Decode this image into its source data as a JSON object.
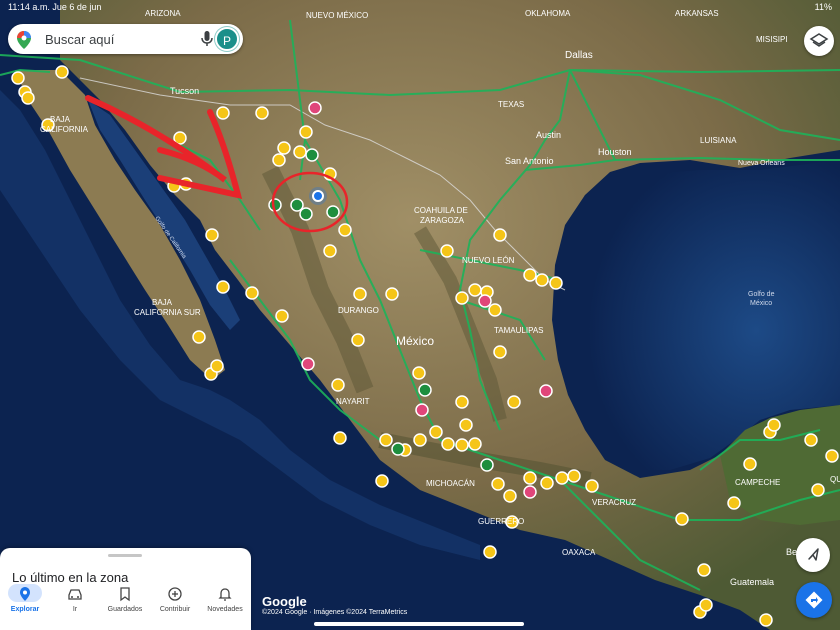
{
  "status_bar": {
    "time": "11:14 a.m.  Jue 6 de jun",
    "battery": "11%"
  },
  "search": {
    "placeholder": "Buscar aquí",
    "avatar_letter": "P"
  },
  "map": {
    "labels": {
      "arizona": "ARIZONA",
      "nuevo_mexico": "NUEVO\nMÉXICO",
      "oklahoma": "OKLAHOMA",
      "arkansas": "ARKANSAS",
      "misisipi": "MISISIPI",
      "dallas": "Dallas",
      "texas": "TEXAS",
      "austin": "Austin",
      "san_antonio": "San Antonio",
      "houston": "Houston",
      "luisiana": "LUISIANA",
      "nueva_orleans": "Nueva Orleans",
      "tucson": "Tucson",
      "baja_california": "BAJA\nCALIFORNIA",
      "golfo_california": "Golfo de California",
      "baja_california_sur": "BAJA\nCALIFORNIA SUR",
      "coahuila": "COAHUILA DE\nZARAGOZA",
      "nuevo_leon": "NUEVO LEÓN",
      "durango": "DURANGO",
      "tamaulipas": "TAMAULIPAS",
      "mexico": "México",
      "golfo_mexico": "Golfo de\nMéxico",
      "nayarit": "NAYARIT",
      "michoacan": "MICHOACÁN",
      "guerrero": "GUERRERO",
      "veracruz": "VERACRUZ",
      "oaxaca": "OAXACA",
      "campeche": "CAMPECHE",
      "quintana": "QUIN",
      "guatemala": "Guatemala",
      "be": "Be"
    }
  },
  "bottom_sheet": {
    "title": "Lo último en la zona",
    "tabs": [
      {
        "label": "Explorar",
        "icon": "location-pin-icon",
        "active": true
      },
      {
        "label": "Ir",
        "icon": "car-icon",
        "active": false
      },
      {
        "label": "Guardados",
        "icon": "bookmark-icon",
        "active": false
      },
      {
        "label": "Contribuir",
        "icon": "add-circle-icon",
        "active": false
      },
      {
        "label": "Novedades",
        "icon": "bell-icon",
        "active": false
      }
    ]
  },
  "watermark": "Google",
  "attribution": "©2024 Google · Imágenes ©2024 TerraMetrics",
  "colors": {
    "water": "#0c2350",
    "land": "#8a7a55",
    "road": "#1db35a",
    "marker_yellow": "#f5c518",
    "marker_green": "#1e8e3e",
    "marker_pink": "#e0467a",
    "annotation_red": "#e8242a"
  }
}
